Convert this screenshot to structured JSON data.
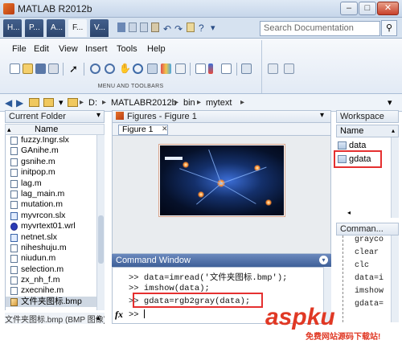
{
  "window": {
    "title": "MATLAB R2012b",
    "buttons": {
      "minimize": "–",
      "maximize": "□",
      "close": "✕"
    }
  },
  "tabs": [
    {
      "label": "H..."
    },
    {
      "label": "P..."
    },
    {
      "label": "A..."
    },
    {
      "label": "F..."
    },
    {
      "label": "V..."
    }
  ],
  "search": {
    "placeholder": "Search Documentation",
    "icon": "search-icon"
  },
  "menu": {
    "file": "File",
    "edit": "Edit",
    "view": "View",
    "insert": "Insert",
    "tools": "Tools",
    "help": "Help"
  },
  "ribbon": {
    "label": "MENU AND TOOLBARS"
  },
  "address": {
    "drive": "D:",
    "segments": [
      "MATLABR2012b",
      "bin",
      "mytext"
    ]
  },
  "current_folder": {
    "title": "Current Folder",
    "column": "Name",
    "files": [
      {
        "name": "fuzzy.Ingr.slx",
        "type": "m"
      },
      {
        "name": "GAnihe.m",
        "type": "m"
      },
      {
        "name": "gsnihe.m",
        "type": "m"
      },
      {
        "name": "initpop.m",
        "type": "m"
      },
      {
        "name": "lag.m",
        "type": "m"
      },
      {
        "name": "lag_main.m",
        "type": "m"
      },
      {
        "name": "mutation.m",
        "type": "m"
      },
      {
        "name": "myvrcon.slx",
        "type": "slx"
      },
      {
        "name": "myvrtext01.wrl",
        "type": "wrl"
      },
      {
        "name": "netnet.slx",
        "type": "slx"
      },
      {
        "name": "niheshuju.m",
        "type": "m"
      },
      {
        "name": "niudun.m",
        "type": "m"
      },
      {
        "name": "selection.m",
        "type": "m"
      },
      {
        "name": "zx_nh_f.m",
        "type": "m"
      },
      {
        "name": "zxecnihe.m",
        "type": "m"
      },
      {
        "name": "文件夹图标.bmp",
        "type": "bmp"
      }
    ],
    "status": "文件夹图标.bmp (BMP 图像)"
  },
  "figures": {
    "title": "Figures - Figure 1",
    "tab": "Figure 1"
  },
  "command_window": {
    "title": "Command Window",
    "lines": [
      ">> data=imread('文件夹图标.bmp');",
      ">> imshow(data);",
      ">> gdata=rgb2gray(data);"
    ],
    "prompt": "fx >>"
  },
  "workspace": {
    "title": "Workspace",
    "column": "Name",
    "vars": [
      "data",
      "gdata"
    ]
  },
  "history": {
    "title": "Comman...",
    "items": [
      "grayco",
      "clear",
      "clc",
      "data=i",
      "imshow",
      "gdata="
    ]
  },
  "watermark": {
    "main": "aspku",
    "sub": "免费网站源码下载站!"
  }
}
